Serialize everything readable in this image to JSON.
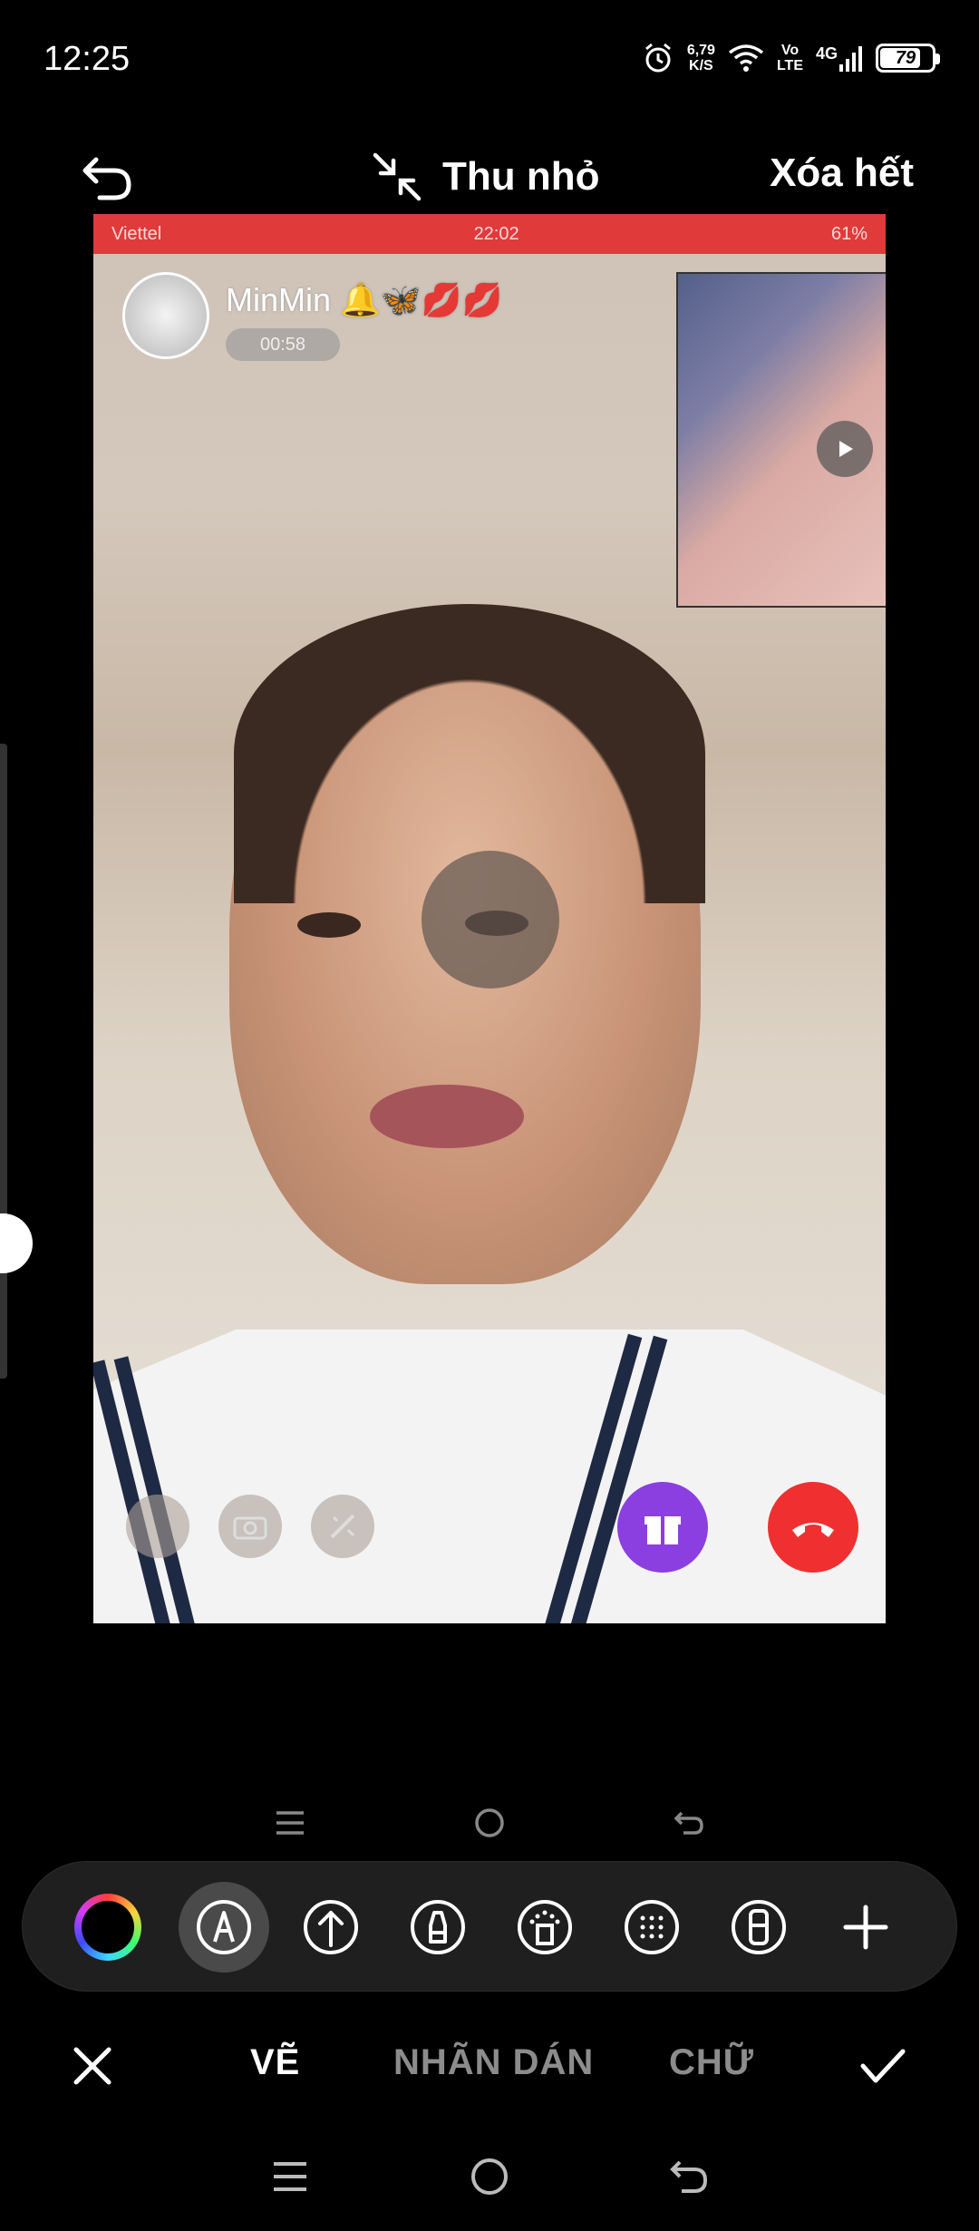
{
  "status_bar": {
    "time": "12:25",
    "net_speed_value": "6,79",
    "net_speed_unit": "K/S",
    "volte_top": "Vo",
    "volte_bottom": "LTE",
    "network": "4G",
    "battery": "79",
    "battery_level_percent": 79
  },
  "top_bar": {
    "shrink_label": "Thu nhỏ",
    "clear_all_label": "Xóa hết"
  },
  "screenshot_content": {
    "inner_status_time": "22:02",
    "inner_status_left": "Viettel",
    "inner_status_right": "61%",
    "caller_name": "MinMin 🔔🦋💋💋",
    "call_timer": "00:58"
  },
  "drawing_tools": [
    {
      "name": "color-picker"
    },
    {
      "name": "pen-tool",
      "active": true
    },
    {
      "name": "arrow-tool"
    },
    {
      "name": "marker-tool"
    },
    {
      "name": "spray-tool"
    },
    {
      "name": "mosaic-tool"
    },
    {
      "name": "eraser-tool"
    },
    {
      "name": "add-tool"
    }
  ],
  "mode_bar": {
    "draw_label": "VẼ",
    "sticker_label": "NHÃN DÁN",
    "text_label": "CHỮ",
    "active_mode": "VẼ"
  },
  "colors": {
    "background": "#000000",
    "toolbar_bg": "#1f1f1f",
    "active_tool_bg": "#4a4a4a",
    "inactive_tab": "#8c8c8c",
    "hangup": "#f03030",
    "gift": "#8b3fe0",
    "inner_status_bar": "#e03a3a"
  }
}
